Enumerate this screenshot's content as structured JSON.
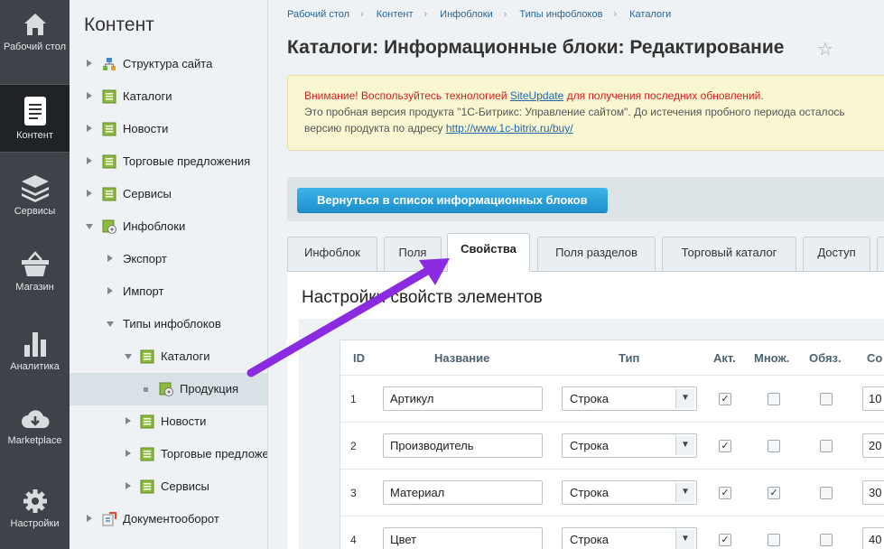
{
  "leftnav": {
    "items": [
      {
        "label": "Рабочий стол",
        "icon": "home-icon"
      },
      {
        "label": "Контент",
        "icon": "document-icon"
      },
      {
        "label": "Сервисы",
        "icon": "layers-icon"
      },
      {
        "label": "Магазин",
        "icon": "basket-icon"
      },
      {
        "label": "Аналитика",
        "icon": "bar-chart-icon"
      },
      {
        "label": "Marketplace",
        "icon": "cloud-download-icon"
      },
      {
        "label": "Настройки",
        "icon": "gear-icon"
      }
    ]
  },
  "tree": {
    "title": "Контент",
    "items": [
      {
        "label": "Структура сайта",
        "icon": "sitemap-icon"
      },
      {
        "label": "Каталоги",
        "icon": "iblock-icon"
      },
      {
        "label": "Новости",
        "icon": "iblock-icon"
      },
      {
        "label": "Торговые предложения",
        "icon": "iblock-icon"
      },
      {
        "label": "Сервисы",
        "icon": "iblock-icon"
      },
      {
        "label": "Инфоблоки",
        "icon": "iblock-settings-icon"
      },
      {
        "label": "Экспорт",
        "icon": ""
      },
      {
        "label": "Импорт",
        "icon": ""
      },
      {
        "label": "Типы инфоблоков",
        "icon": ""
      },
      {
        "label": "Каталоги",
        "icon": "iblock-icon"
      },
      {
        "label": "Продукция",
        "icon": "iblock-settings-icon"
      },
      {
        "label": "Новости",
        "icon": "iblock-icon"
      },
      {
        "label": "Торговые предложе",
        "icon": "iblock-icon"
      },
      {
        "label": "Сервисы",
        "icon": "iblock-icon"
      },
      {
        "label": "Документооборот",
        "icon": "workflow-icon"
      }
    ]
  },
  "breadcrumbs": [
    "Рабочий стол",
    "Контент",
    "Инфоблоки",
    "Типы инфоблоков",
    "Каталоги"
  ],
  "page": {
    "title": "Каталоги: Информационные блоки: Редактирование"
  },
  "notice": {
    "warn_prefix": "Внимание! Воспользуйтесь технологией ",
    "warn_link": "SiteUpdate",
    "warn_suffix": " для получения последних обновлений.",
    "line2": "Это пробная версия продукта \"1С-Битрикс: Управление сайтом\". До истечения пробного периода осталось",
    "line3_prefix": "версию продукта по адресу ",
    "line3_link": "http://www.1c-bitrix.ru/buy/"
  },
  "back_button": "Вернуться в список информационных блоков",
  "tabs": [
    "Инфоблок",
    "Поля",
    "Свойства",
    "Поля разделов",
    "Торговый каталог",
    "Доступ"
  ],
  "panel": {
    "title": "Настройки свойств элементов"
  },
  "table": {
    "headers": {
      "id": "ID",
      "name": "Название",
      "type": "Тип",
      "active": "Акт.",
      "multiple": "Множ.",
      "required": "Обяз.",
      "sort": "Со"
    },
    "rows": [
      {
        "id": "1",
        "name": "Артикул",
        "type": "Строка",
        "active": true,
        "multiple": false,
        "required": false,
        "sort": "10"
      },
      {
        "id": "2",
        "name": "Производитель",
        "type": "Строка",
        "active": true,
        "multiple": false,
        "required": false,
        "sort": "20"
      },
      {
        "id": "3",
        "name": "Материал",
        "type": "Строка",
        "active": true,
        "multiple": true,
        "required": false,
        "sort": "30"
      },
      {
        "id": "4",
        "name": "Цвет",
        "type": "Строка",
        "active": true,
        "multiple": false,
        "required": false,
        "sort": "40"
      }
    ]
  }
}
